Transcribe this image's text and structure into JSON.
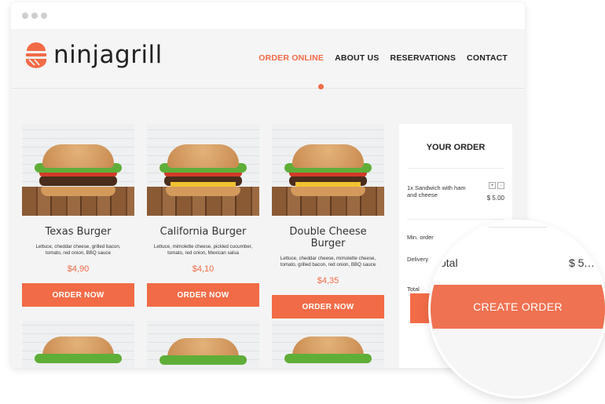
{
  "brand": {
    "name": "ninjagrill",
    "accent_color": "#f26b47"
  },
  "nav": {
    "items": [
      {
        "label": "ORDER ONLINE",
        "active": true
      },
      {
        "label": "ABOUT US",
        "active": false
      },
      {
        "label": "RESERVATIONS",
        "active": false
      },
      {
        "label": "CONTACT",
        "active": false
      }
    ]
  },
  "menu": {
    "items": [
      {
        "name": "Texas Burger",
        "description": "Lettuce, cheddar cheese, grilled bacon, tomato, red onion, BBQ sauce",
        "price": "$4,90",
        "button_label": "ORDER NOW"
      },
      {
        "name": "California Burger",
        "description": "Lettuce, mimolette cheese, pickled cucumber, tomato, red onion, Mexican salsa",
        "price": "$4,10",
        "button_label": "ORDER NOW"
      },
      {
        "name": "Double Cheese Burger",
        "description": "Lettuce, cheddar cheese, mimolette cheese, tomato, grilled bacon, red onion, BBQ sauce",
        "price": "$4,35",
        "button_label": "ORDER NOW"
      }
    ]
  },
  "order": {
    "title": "YOUR ORDER",
    "item": {
      "name": "1x Sandwich with ham and cheese",
      "price": "$ 5.00",
      "plus_label": "+",
      "minus_label": "-"
    },
    "min_order_label": "Min. order",
    "delivery_label": "Delivery",
    "total_label": "Total",
    "button_label": "CREATE ORDER"
  },
  "magnifier": {
    "total_label": "otal",
    "total_value": "$ 5.…",
    "button_label": "CREATE ORDER"
  }
}
